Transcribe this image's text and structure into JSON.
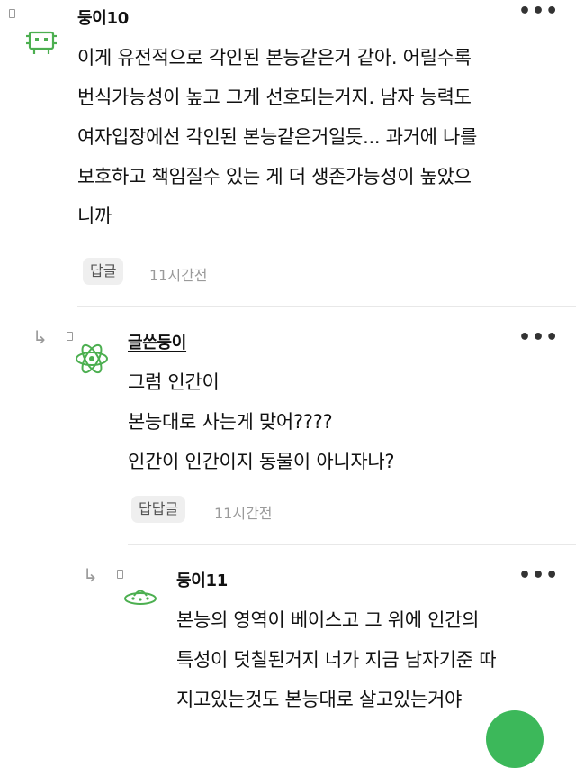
{
  "comments": [
    {
      "nickname": "둥이10",
      "body_lines": [
        "이게 유전적으로 각인된 본능같은거 같아. 어릴수록",
        "번식가능성이 높고 그게 선호되는거지. 남자 능력도",
        "여자입장에선 각인된 본능같은거일듯... 과거에 나를",
        "보호하고 책임질수 있는 게 더 생존가능성이 높았으",
        "니까"
      ],
      "reply_label": "답글",
      "time": "11시간전",
      "avatar_icon": "space-invader-icon"
    },
    {
      "nickname": "글쓴둥이",
      "body_lines": [
        "그럼 인간이",
        "본능대로 사는게 맞어????",
        "인간이 인간이지 동물이 아니자나?"
      ],
      "reply_label": "답답글",
      "time": "11시간전",
      "avatar_icon": "atom-icon"
    },
    {
      "nickname": "둥이11",
      "body_lines": [
        "본능의 영역이 베이스고 그 위에 인간의",
        "특성이 덧칠된거지 너가 지금 남자기준 따",
        "지고있는것도 본능대로 살고있는거야"
      ],
      "avatar_icon": "ufo-icon"
    }
  ],
  "more_label": "•••",
  "colors": {
    "accent": "#3cb85a",
    "avatar_green": "#4caf50",
    "muted": "#9a9a9a"
  }
}
